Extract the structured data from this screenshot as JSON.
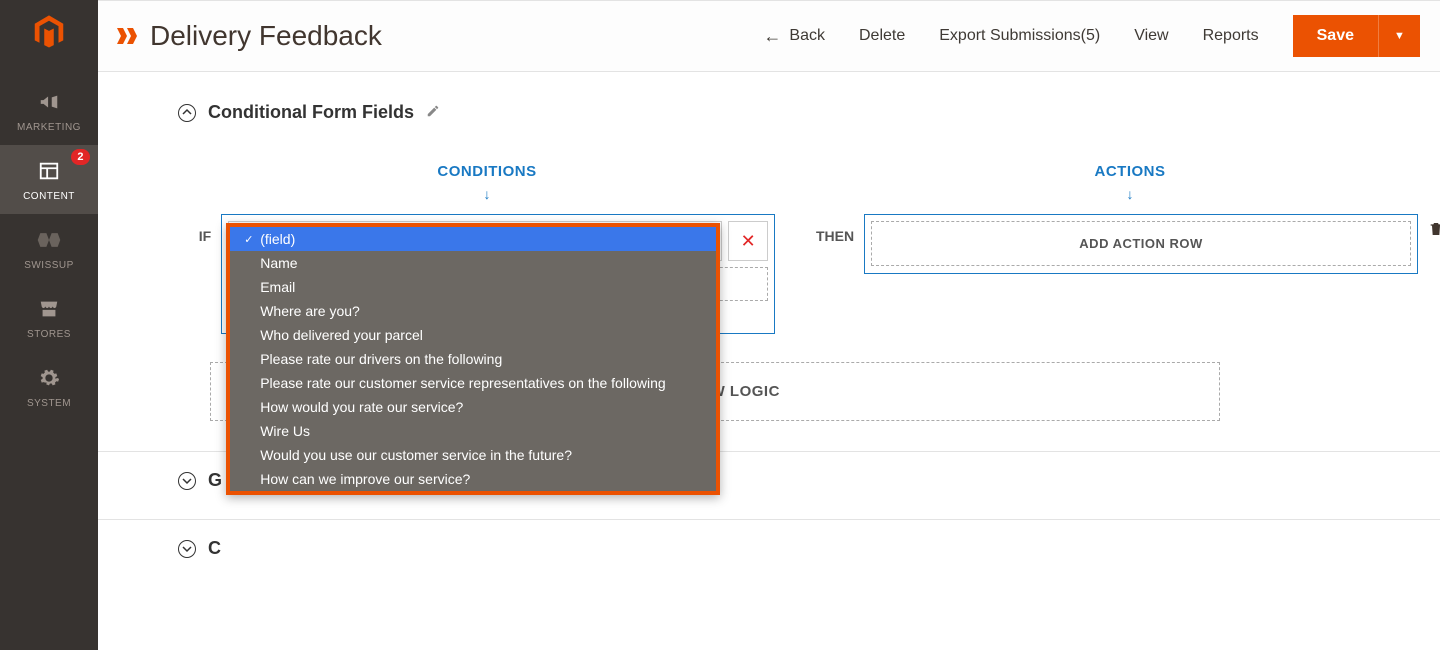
{
  "sidebar": {
    "items": [
      {
        "label": "MARKETING"
      },
      {
        "label": "CONTENT",
        "badge": "2"
      },
      {
        "label": "SWISSUP"
      },
      {
        "label": "STORES"
      },
      {
        "label": "SYSTEM"
      }
    ]
  },
  "header": {
    "title": "Delivery Feedback",
    "back": "Back",
    "delete": "Delete",
    "export": "Export Submissions(5)",
    "view": "View",
    "reports": "Reports",
    "save": "Save"
  },
  "section": {
    "title": "Conditional Form Fields",
    "conditions": "CONDITIONS",
    "actions": "ACTIONS",
    "if": "IF",
    "then": "THEN",
    "add_action": "ADD ACTION ROW",
    "add_logic": "ADD NEW LOGIC"
  },
  "dropdown": {
    "items": [
      "(field)",
      "Name",
      "Email",
      "Where are you?",
      "Who delivered your parcel",
      "Please rate our drivers on the following",
      "Please rate our customer service representatives on the following",
      "How would you rate our service?",
      "Wire Us",
      "Would you use our customer service in the future?",
      "How can we improve our service?"
    ]
  },
  "collapsed": {
    "g": "G",
    "coupon_prefix": "C"
  }
}
